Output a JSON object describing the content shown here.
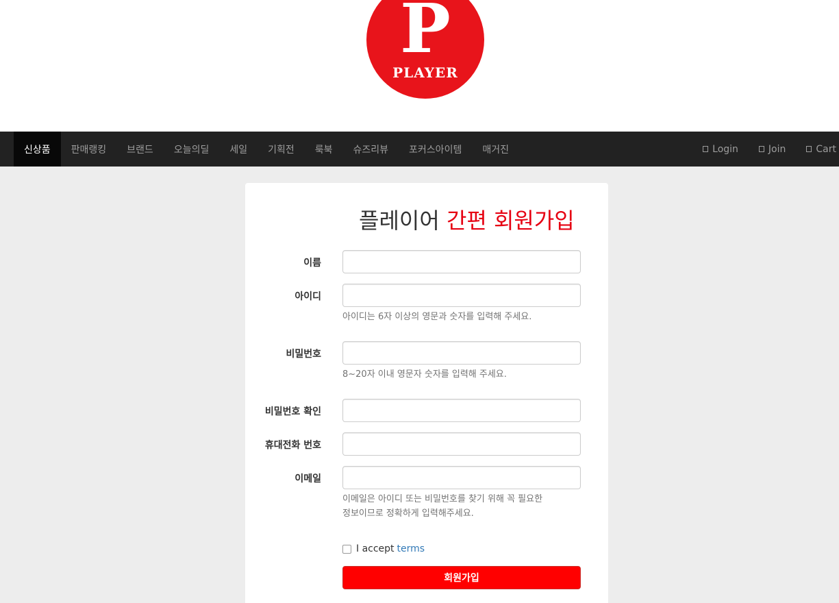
{
  "logo": {
    "letter": "P",
    "word": "PLAYER",
    "color": "#e8141b"
  },
  "nav": {
    "items": [
      "신상품",
      "판매랭킹",
      "브랜드",
      "오늘의딜",
      "세일",
      "기획전",
      "룩북",
      "슈즈리뷰",
      "포커스아이템",
      "매거진"
    ],
    "active_index": 0,
    "right": [
      {
        "label": "Login",
        "icon": "login-icon"
      },
      {
        "label": "Join",
        "icon": "join-icon"
      },
      {
        "label": "Cart",
        "icon": "cart-icon"
      }
    ]
  },
  "form": {
    "title_black": "플레이어",
    "title_red": "간편 회원가입",
    "fields": [
      {
        "label": "이름",
        "value": ""
      },
      {
        "label": "아이디",
        "value": "",
        "help": "아이디는 6자 이상의 영문과 숫자를 입력해 주세요."
      },
      {
        "label": "비밀번호",
        "value": "",
        "help": "8~20자 이내 영문자 숫자를 입력해 주세요."
      },
      {
        "label": "비밀번호 확인",
        "value": ""
      },
      {
        "label": "휴대전화 번호",
        "value": ""
      },
      {
        "label": "이메일",
        "value": "",
        "help_line1": "이메일은 아이디 또는 비밀번호를 찾기 위해 꼭 필요한",
        "help_line2": "정보이므로 정확하게 입력해주세요."
      }
    ],
    "terms_text": "I accept",
    "terms_link": "terms",
    "terms_checked": false,
    "submit_label": "회원가입",
    "accent_color": "#ff0000"
  }
}
